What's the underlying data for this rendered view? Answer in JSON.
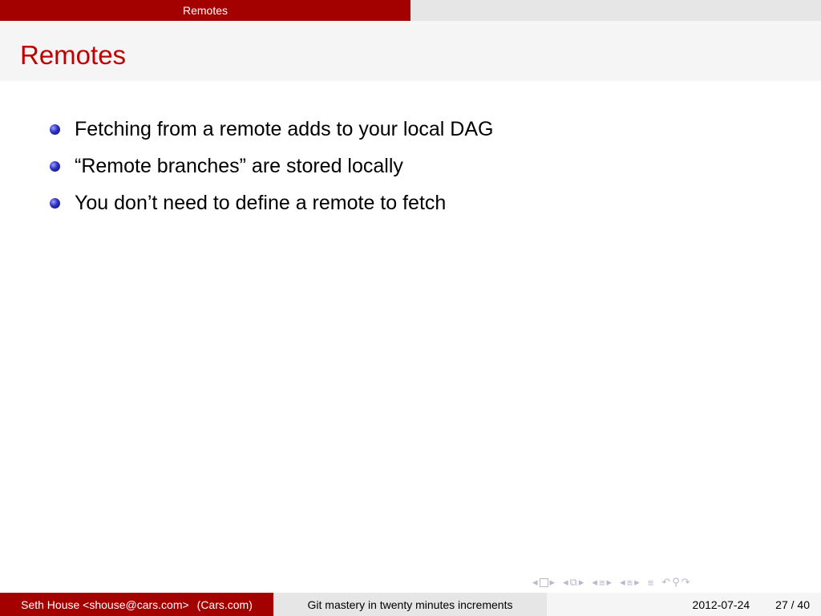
{
  "header": {
    "section": "Remotes"
  },
  "slide": {
    "title": "Remotes",
    "bullets": [
      "Fetching from a remote adds to your local DAG",
      "“Remote branches” are stored locally",
      "You don’t need to define a remote to fetch"
    ]
  },
  "footer": {
    "author": "Seth House <shouse@cars.com>",
    "institute": "(Cars.com)",
    "talk_title": "Git mastery in twenty minutes increments",
    "date": "2012-07-24",
    "page": "27 / 40"
  },
  "nav": {
    "icons": [
      "left-arrow-icon",
      "frame-icon",
      "right-arrow-icon",
      "subsection-icon",
      "section-icon",
      "align-icon",
      "undo-icon",
      "search-icon",
      "redo-icon"
    ]
  },
  "colors": {
    "accent": "#a30000",
    "title": "#c00000",
    "bar_gray": "#e6e6e6",
    "bar_light": "#f5f5f5"
  }
}
